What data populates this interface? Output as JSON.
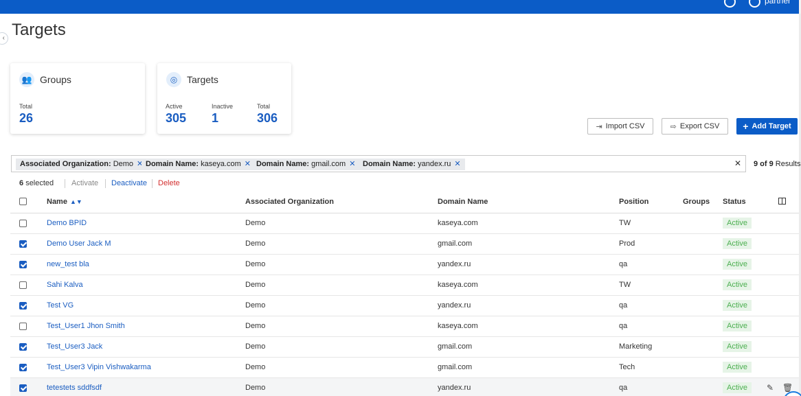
{
  "header": {
    "user_name": "partner"
  },
  "page": {
    "title": "Targets"
  },
  "cards": {
    "groups": {
      "title": "Groups",
      "stats": [
        {
          "label": "Total",
          "value": "26"
        }
      ]
    },
    "targets": {
      "title": "Targets",
      "stats": [
        {
          "label": "Active",
          "value": "305"
        },
        {
          "label": "Inactive",
          "value": "1"
        },
        {
          "label": "Total",
          "value": "306"
        }
      ]
    }
  },
  "toolbar": {
    "import_label": "Import CSV",
    "export_label": "Export CSV",
    "add_label": "Add Target"
  },
  "filters": [
    {
      "key": "Associated Organization:",
      "value": "Demo"
    },
    {
      "key": "Domain Name:",
      "value": "kaseya.com"
    },
    {
      "key": "Domain Name:",
      "value": "gmail.com"
    },
    {
      "key": "Domain Name:",
      "value": "yandex.ru"
    }
  ],
  "results": {
    "count": "9 of 9",
    "suffix": "Results"
  },
  "bulk_actions": {
    "selected_count": "6",
    "selected_suffix": "selected",
    "activate": "Activate",
    "deactivate": "Deactivate",
    "delete": "Delete"
  },
  "table": {
    "columns": [
      "Name",
      "Associated Organization",
      "Domain Name",
      "Position",
      "Groups",
      "Status"
    ],
    "rows": [
      {
        "checked": false,
        "name": "Demo BPID",
        "org": "Demo",
        "domain": "kaseya.com",
        "position": "TW",
        "groups": "",
        "status": "Active"
      },
      {
        "checked": true,
        "name": "Demo User Jack M",
        "org": "Demo",
        "domain": "gmail.com",
        "position": "Prod",
        "groups": "",
        "status": "Active"
      },
      {
        "checked": true,
        "name": "new_test bla",
        "org": "Demo",
        "domain": "yandex.ru",
        "position": "qa",
        "groups": "",
        "status": "Active"
      },
      {
        "checked": false,
        "name": "Sahi Kalva",
        "org": "Demo",
        "domain": "kaseya.com",
        "position": "TW",
        "groups": "",
        "status": "Active"
      },
      {
        "checked": true,
        "name": "Test VG",
        "org": "Demo",
        "domain": "yandex.ru",
        "position": "qa",
        "groups": "",
        "status": "Active"
      },
      {
        "checked": false,
        "name": "Test_User1 Jhon Smith",
        "org": "Demo",
        "domain": "kaseya.com",
        "position": "qa",
        "groups": "",
        "status": "Active"
      },
      {
        "checked": true,
        "name": "Test_User3 Jack",
        "org": "Demo",
        "domain": "gmail.com",
        "position": "Marketing",
        "groups": "",
        "status": "Active"
      },
      {
        "checked": true,
        "name": "Test_User3 Vipin Vishwakarma",
        "org": "Demo",
        "domain": "gmail.com",
        "position": "Tech",
        "groups": "",
        "status": "Active"
      },
      {
        "checked": true,
        "name": "tetestets sddfsdf",
        "org": "Demo",
        "domain": "yandex.ru",
        "position": "qa",
        "groups": "",
        "status": "Active"
      }
    ]
  },
  "colors": {
    "primary": "#0b5cc7",
    "link": "#1a5dc1",
    "danger": "#d32f2f",
    "active_bg": "#e6f4e7",
    "active_fg": "#4caf50"
  }
}
